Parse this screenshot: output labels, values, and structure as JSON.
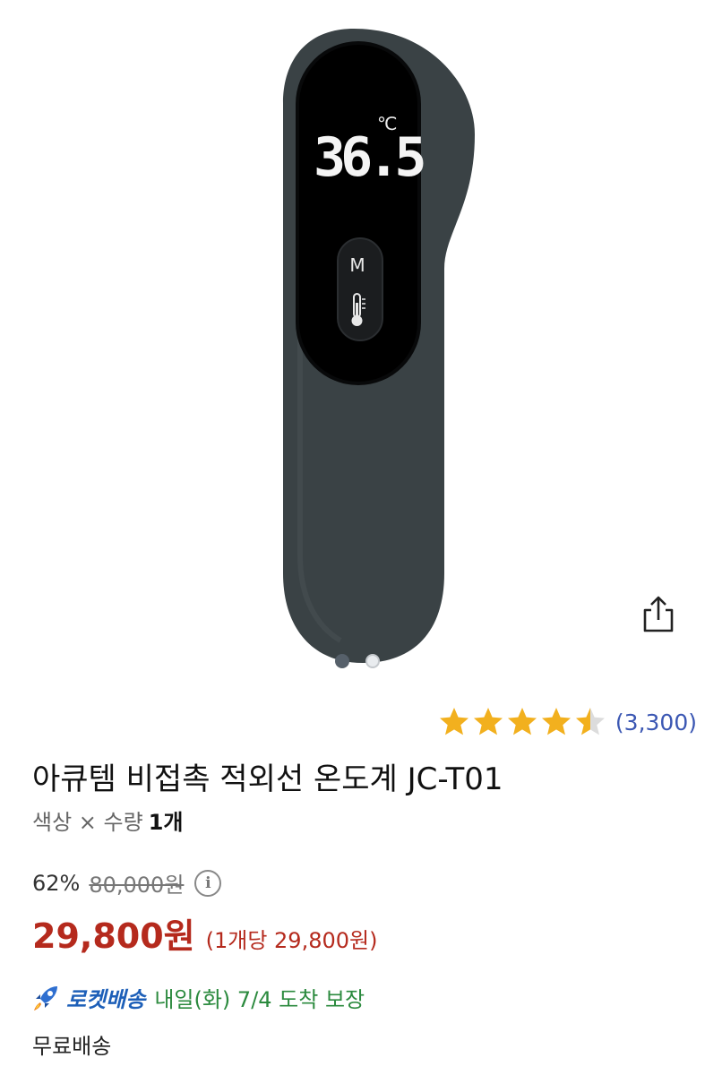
{
  "product_image": {
    "display_reading": "36.5",
    "display_unit": "℃",
    "mode_button_letter": "M",
    "carousel": {
      "count": 2,
      "active_index": 0
    }
  },
  "rating": {
    "stars": 4.5,
    "count_text": "(3,300)",
    "color": "#f2b01e"
  },
  "title": "아큐템 비접촉 적외선 온도계 JC-T01",
  "options": {
    "label": "색상 × 수량",
    "value": "1개"
  },
  "price": {
    "discount_rate": "62%",
    "original_price": "80,000원",
    "sale_price": "29,800원",
    "unit_price": "(1개당 29,800원)",
    "sale_color": "#b52a1d"
  },
  "delivery": {
    "badge_label": "로켓배송",
    "arrival_text": "내일(화) 7/4 도착 보장",
    "shipping_fee": "무료배송"
  },
  "icons": {
    "share": "share-icon",
    "info": "info-icon",
    "rocket": "rocket-icon",
    "thermometer": "thermometer-icon"
  }
}
